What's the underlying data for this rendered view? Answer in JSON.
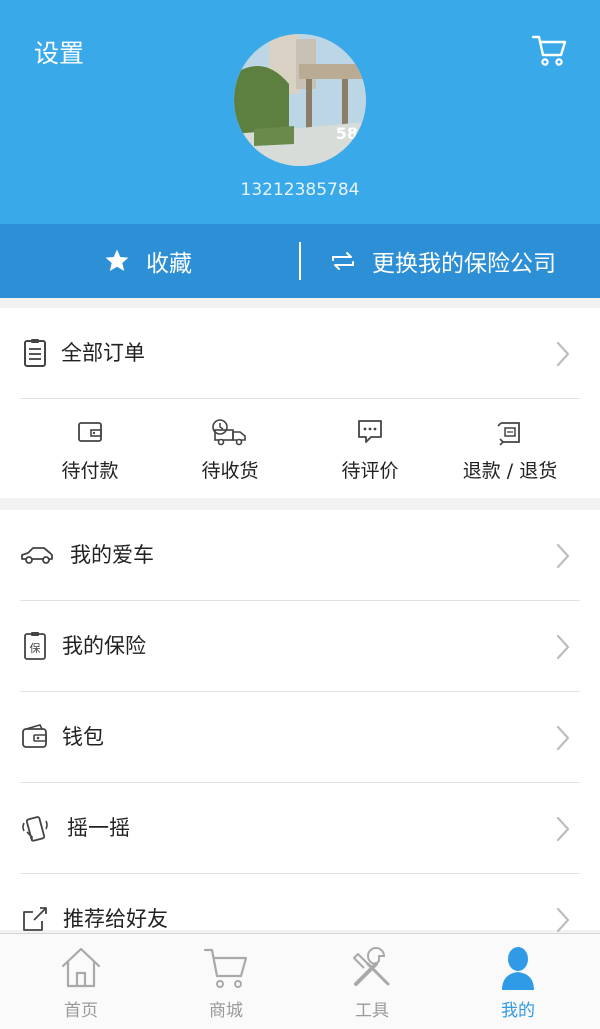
{
  "header": {
    "settings_label": "设置",
    "phone": "13212385784",
    "avatar_watermark": "58"
  },
  "quickbar": {
    "favorites_label": "收藏",
    "switch_insurer_label": "更换我的保险公司"
  },
  "orders": {
    "all_orders_label": "全部订单",
    "statuses": [
      {
        "label": "待付款",
        "icon": "wallet-icon"
      },
      {
        "label": "待收货",
        "icon": "delivery-truck-icon"
      },
      {
        "label": "待评价",
        "icon": "comment-icon"
      },
      {
        "label": "退款 / 退货",
        "icon": "refund-icon"
      }
    ]
  },
  "menu": {
    "items": [
      {
        "label": "我的爱车",
        "icon": "car-icon"
      },
      {
        "label": "我的保险",
        "icon": "insurance-icon"
      },
      {
        "label": "钱包",
        "icon": "wallet-icon"
      },
      {
        "label": "摇一摇",
        "icon": "shake-icon"
      },
      {
        "label": "推荐给好友",
        "icon": "share-icon"
      }
    ]
  },
  "tabbar": {
    "tabs": [
      {
        "label": "首页",
        "icon": "home-icon"
      },
      {
        "label": "商城",
        "icon": "cart-icon"
      },
      {
        "label": "工具",
        "icon": "tools-icon"
      },
      {
        "label": "我的",
        "icon": "person-icon"
      }
    ],
    "active_index": 3
  },
  "colors": {
    "header_bg": "#3aa9ea",
    "quickbar_bg": "#2d8fd6",
    "active_tab": "#2f9be6"
  }
}
